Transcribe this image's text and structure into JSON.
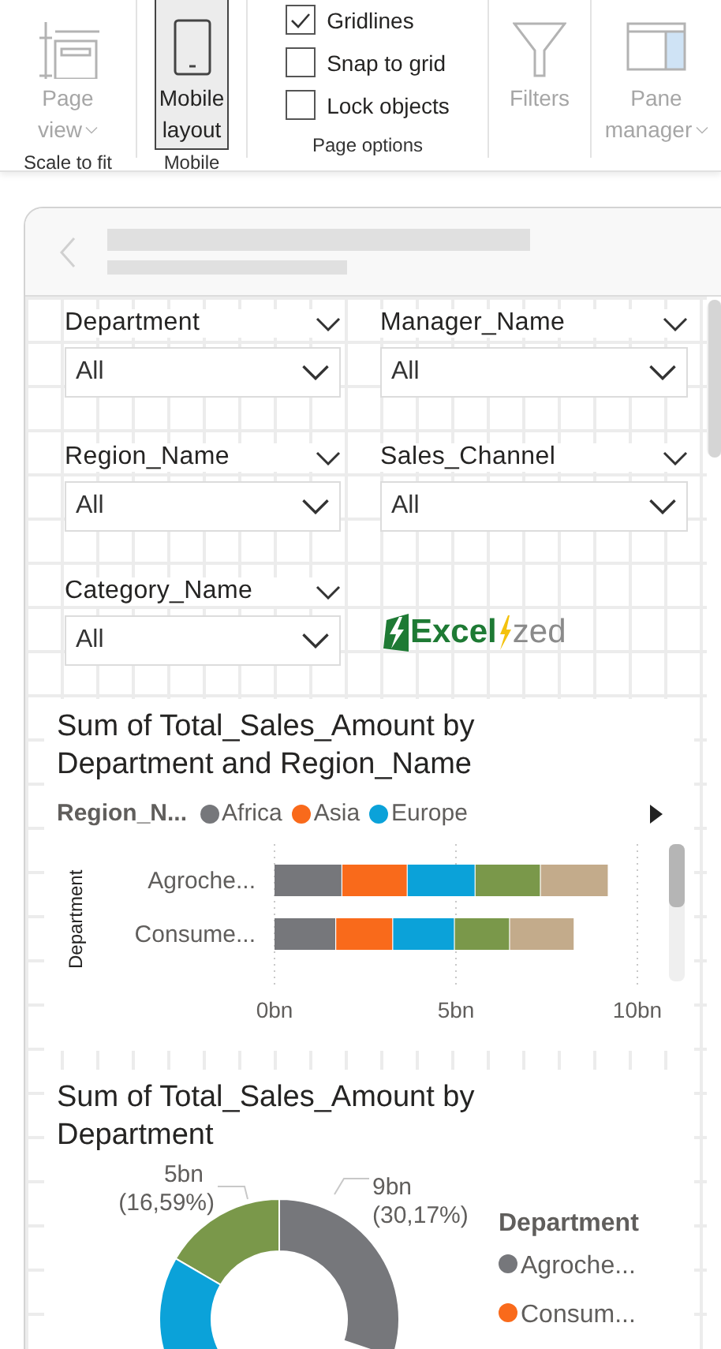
{
  "ribbon": {
    "groups": [
      {
        "caption": "Scale to fit",
        "kind": "button",
        "button": {
          "lines": [
            "Page",
            "view"
          ],
          "dropdown": true,
          "disabled": true,
          "selected": false
        }
      },
      {
        "caption": "Mobile",
        "kind": "button",
        "button": {
          "lines": [
            "Mobile",
            "layout"
          ],
          "disabled": false,
          "selected": true
        }
      },
      {
        "caption": "Page options",
        "kind": "checks",
        "checks": [
          {
            "label": "Gridlines",
            "checked": true
          },
          {
            "label": "Snap to grid",
            "checked": false
          },
          {
            "label": "Lock objects",
            "checked": false
          }
        ]
      },
      {
        "kind": "button",
        "button": {
          "lines": [
            "Filters"
          ],
          "disabled": true,
          "selected": false
        }
      },
      {
        "kind": "button",
        "button": {
          "lines": [
            "Pane",
            "manager"
          ],
          "dropdown": true,
          "disabled": true,
          "selected": false
        }
      }
    ]
  },
  "slicers": [
    {
      "label": "Department",
      "value": "All"
    },
    {
      "label": "Manager_Name",
      "value": "All"
    },
    {
      "label": "Region_Name",
      "value": "All"
    },
    {
      "label": "Sales_Channel",
      "value": "All"
    },
    {
      "label": "Category_Name",
      "value": "All"
    }
  ],
  "logo": {
    "bold_part": "Excel",
    "light_part": "zed"
  },
  "bar_chart": {
    "title": "Sum of Total_Sales_Amount by Department and Region_Name",
    "legend_title": "Region_N...",
    "chart_data": {
      "type": "bar",
      "orientation": "horizontal",
      "stacked": true,
      "ylabel": "Department",
      "categories": [
        "Agroche...",
        "Consume..."
      ],
      "series": [
        {
          "name": "Africa",
          "color": "#76777b",
          "values": [
            1.87,
            1.7
          ]
        },
        {
          "name": "Asia",
          "color": "#f96a1b",
          "values": [
            1.8,
            1.57
          ]
        },
        {
          "name": "Europe",
          "color": "#0ba2d9",
          "values": [
            1.87,
            1.7
          ]
        },
        {
          "color": "#7a984a",
          "values": [
            1.8,
            1.52
          ]
        },
        {
          "color": "#c3ab8b",
          "values": [
            1.87,
            1.78
          ]
        }
      ],
      "xlim": [
        0,
        10
      ],
      "xticks": [
        {
          "value": 0,
          "label": "0bn"
        },
        {
          "value": 5,
          "label": "5bn"
        },
        {
          "value": 10,
          "label": "10bn"
        }
      ]
    }
  },
  "donut": {
    "title": "Sum of Total_Sales_Amount by Department",
    "labels": [
      {
        "value": "5bn",
        "share": "(16,59%)"
      },
      {
        "value": "9bn",
        "share": "(30,17%)"
      }
    ],
    "legend_title": "Department",
    "legend": [
      {
        "label": "Agroche...",
        "color": "#76777b"
      },
      {
        "label": "Consum...",
        "color": "#f96a1b"
      }
    ]
  }
}
